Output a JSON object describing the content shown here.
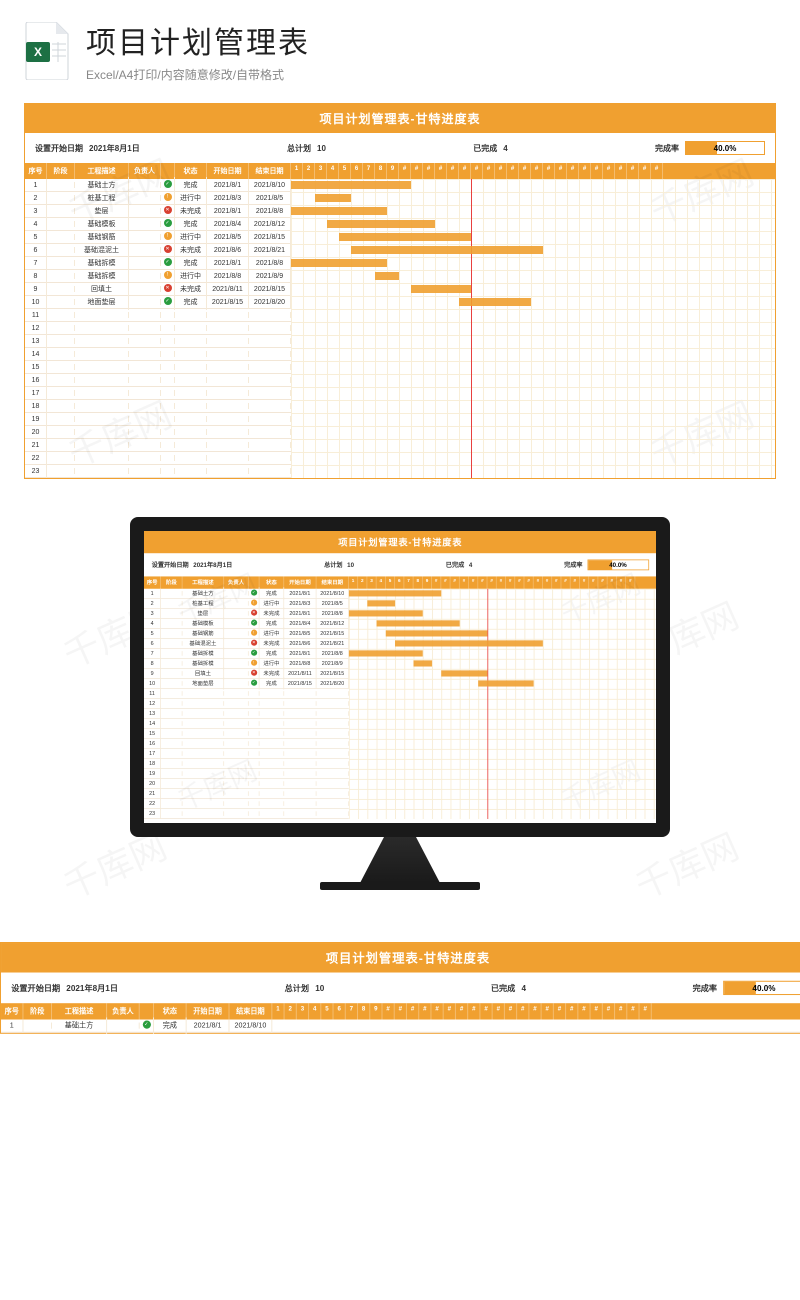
{
  "header": {
    "title": "项目计划管理表",
    "subtitle": "Excel/A4打印/内容随意修改/自带格式"
  },
  "watermark": "千库网",
  "sheet": {
    "banner": "项目计划管理表-甘特进度表",
    "summary": {
      "start_label": "设置开始日期",
      "start_value": "2021年8月1日",
      "total_label": "总计划",
      "total_value": "10",
      "done_label": "已完成",
      "done_value": "4",
      "rate_label": "完成率",
      "rate_pct": "40.0%",
      "rate_fill": 40
    },
    "headers": {
      "seq": "序号",
      "phase": "阶段",
      "desc": "工程描述",
      "owner": "负责人",
      "status": "状态",
      "start": "开始日期",
      "end": "结束日期"
    },
    "day_headers": [
      "1",
      "2",
      "3",
      "4",
      "5",
      "6",
      "7",
      "8",
      "9",
      "#",
      "#",
      "#",
      "#",
      "#",
      "#",
      "#",
      "#",
      "#",
      "#",
      "#",
      "#",
      "#",
      "#",
      "#",
      "#",
      "#",
      "#",
      "#",
      "#",
      "#",
      "#"
    ],
    "status_labels": {
      "done": "完成",
      "prog": "进行中",
      "fail": "未完成"
    },
    "tasks": [
      {
        "seq": 1,
        "desc": "基础土方",
        "status": "done",
        "start": "2021/8/1",
        "end": "2021/8/10",
        "gstart": 0,
        "glen": 10
      },
      {
        "seq": 2,
        "desc": "桩基工程",
        "status": "prog",
        "start": "2021/8/3",
        "end": "2021/8/5",
        "gstart": 2,
        "glen": 3
      },
      {
        "seq": 3,
        "desc": "垫层",
        "status": "fail",
        "start": "2021/8/1",
        "end": "2021/8/8",
        "gstart": 0,
        "glen": 8
      },
      {
        "seq": 4,
        "desc": "基础模板",
        "status": "done",
        "start": "2021/8/4",
        "end": "2021/8/12",
        "gstart": 3,
        "glen": 9
      },
      {
        "seq": 5,
        "desc": "基础钢筋",
        "status": "prog",
        "start": "2021/8/5",
        "end": "2021/8/15",
        "gstart": 4,
        "glen": 11
      },
      {
        "seq": 6,
        "desc": "基础混泥土",
        "status": "fail",
        "start": "2021/8/6",
        "end": "2021/8/21",
        "gstart": 5,
        "glen": 16
      },
      {
        "seq": 7,
        "desc": "基础拆模",
        "status": "done",
        "start": "2021/8/1",
        "end": "2021/8/8",
        "gstart": 0,
        "glen": 8
      },
      {
        "seq": 8,
        "desc": "基础拆模",
        "status": "prog",
        "start": "2021/8/8",
        "end": "2021/8/9",
        "gstart": 7,
        "glen": 2
      },
      {
        "seq": 9,
        "desc": "回填土",
        "status": "fail",
        "start": "2021/8/11",
        "end": "2021/8/15",
        "gstart": 10,
        "glen": 5
      },
      {
        "seq": 10,
        "desc": "地面垫层",
        "status": "done",
        "start": "2021/8/15",
        "end": "2021/8/20",
        "gstart": 14,
        "glen": 6
      }
    ],
    "empty_rows": 13,
    "today_col": 15
  },
  "bottom_task": {
    "seq": 1,
    "desc": "基础土方",
    "status": "done",
    "start": "2021/8/1",
    "end": "2021/8/10"
  }
}
